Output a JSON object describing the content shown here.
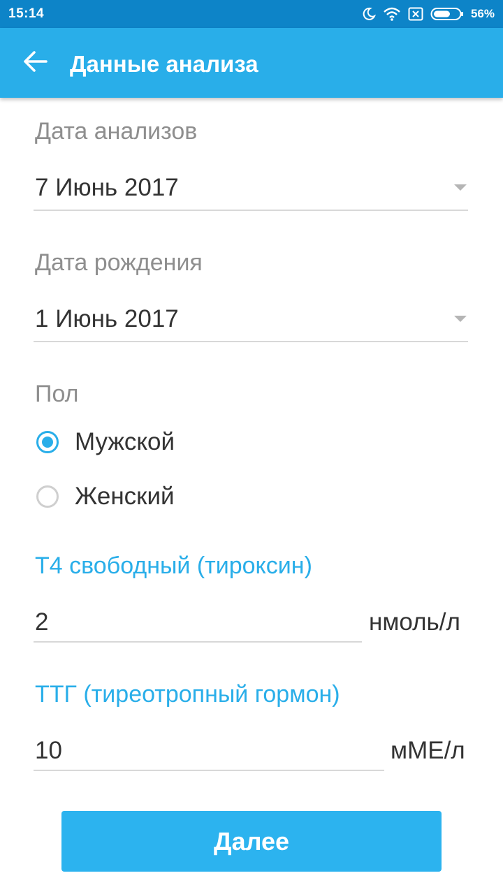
{
  "status_bar": {
    "time": "15:14",
    "battery": "56%",
    "icons": [
      "moon-icon",
      "wifi-icon",
      "no-sim-icon",
      "battery-icon"
    ]
  },
  "app_bar": {
    "back_icon": "arrow-left-icon",
    "title": "Данные анализа"
  },
  "form": {
    "analysis_date": {
      "label": "Дата анализов",
      "value": "7 Июнь 2017"
    },
    "birth_date": {
      "label": "Дата рождения",
      "value": "1 Июнь 2017"
    },
    "gender": {
      "label": "Пол",
      "options": [
        {
          "label": "Мужской",
          "checked": true
        },
        {
          "label": "Женский",
          "checked": false
        }
      ]
    },
    "t4": {
      "label": "Т4 свободный (тироксин)",
      "value": "2",
      "unit": "нмоль/л"
    },
    "tsh": {
      "label": "ТТГ (тиреотропный гормон)",
      "value": "10",
      "unit": "мМЕ/л"
    }
  },
  "next_button": {
    "label": "Далее"
  },
  "colors": {
    "status_bar": "#0d84c8",
    "app_bar": "#29aee9",
    "accent": "#29aee9",
    "button": "#2cb3ef"
  }
}
